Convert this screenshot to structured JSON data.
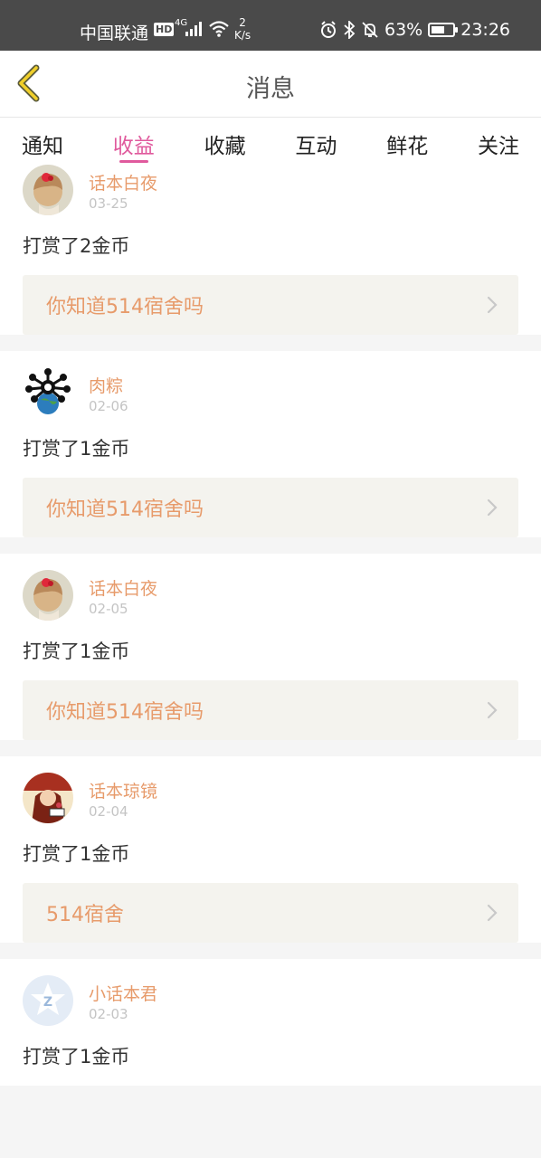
{
  "status_bar": {
    "carrier": "中国联通",
    "hd": "HD",
    "signal_label": "4G",
    "speed_value": "2",
    "speed_unit": "K/s",
    "battery": "63%",
    "battery_level": 0.63,
    "time": "23:26"
  },
  "header": {
    "title": "消息"
  },
  "tabs": [
    {
      "label": "通知",
      "active": false
    },
    {
      "label": "收益",
      "active": true
    },
    {
      "label": "收藏",
      "active": false
    },
    {
      "label": "互动",
      "active": false
    },
    {
      "label": "鲜花",
      "active": false
    },
    {
      "label": "关注",
      "active": false
    }
  ],
  "messages": [
    {
      "user": "话本白夜",
      "date": "03-25",
      "action": "打赏了2金币",
      "story": "你知道514宿舍吗",
      "avatar": "doll-avatar"
    },
    {
      "user": "肉粽",
      "date": "02-06",
      "action": "打赏了1金币",
      "story": "你知道514宿舍吗",
      "avatar": "virus-globe-avatar"
    },
    {
      "user": "话本白夜",
      "date": "02-05",
      "action": "打赏了1金币",
      "story": "你知道514宿舍吗",
      "avatar": "doll-avatar"
    },
    {
      "user": "话本琼镜",
      "date": "02-04",
      "action": "打赏了1金币",
      "story": "514宿舍",
      "avatar": "anime-avatar"
    },
    {
      "user": "小话本君",
      "date": "02-03",
      "action": "打赏了1金币",
      "story": "",
      "avatar": "default-avatar"
    }
  ],
  "colors": {
    "accent": "#e05a9d",
    "username": "#e79b6b",
    "link_bg": "#f4f3ee"
  }
}
